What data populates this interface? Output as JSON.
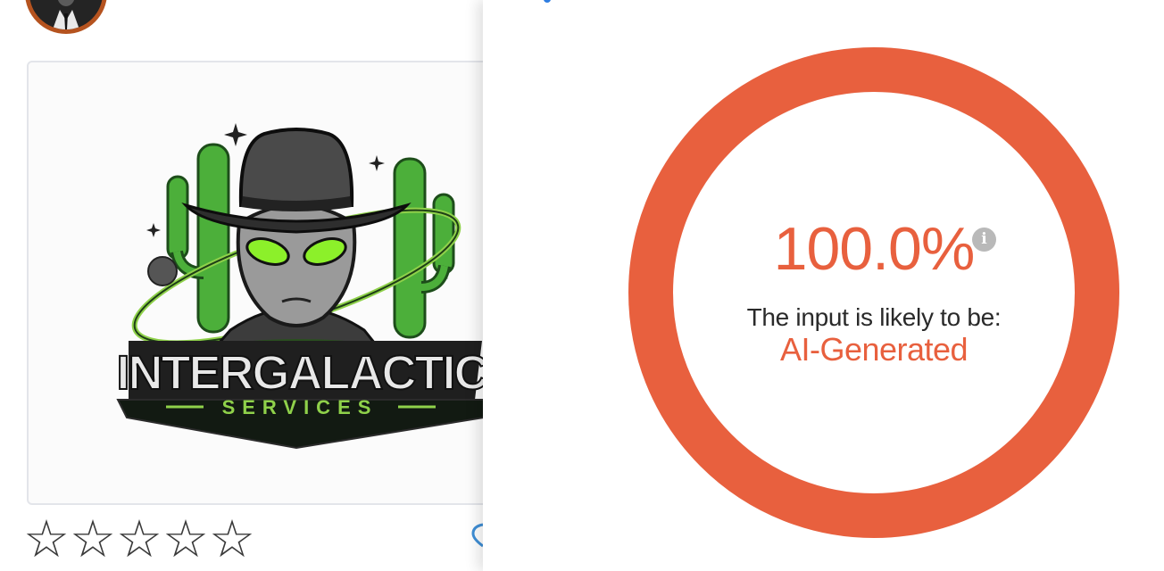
{
  "listing": {
    "logo": {
      "title": "INTERGALACTIC",
      "subtitle": "SERVICES"
    },
    "rating": {
      "value": 0,
      "max": 5,
      "star_glyph": "☆"
    }
  },
  "detection": {
    "score": "100.0%",
    "score_fraction": 1.0,
    "caption": "The input is likely to be:",
    "verdict": "AI-Generated",
    "info_glyph": "i",
    "colors": {
      "ring": "#e8603e",
      "verdict": "#e8603e"
    }
  }
}
